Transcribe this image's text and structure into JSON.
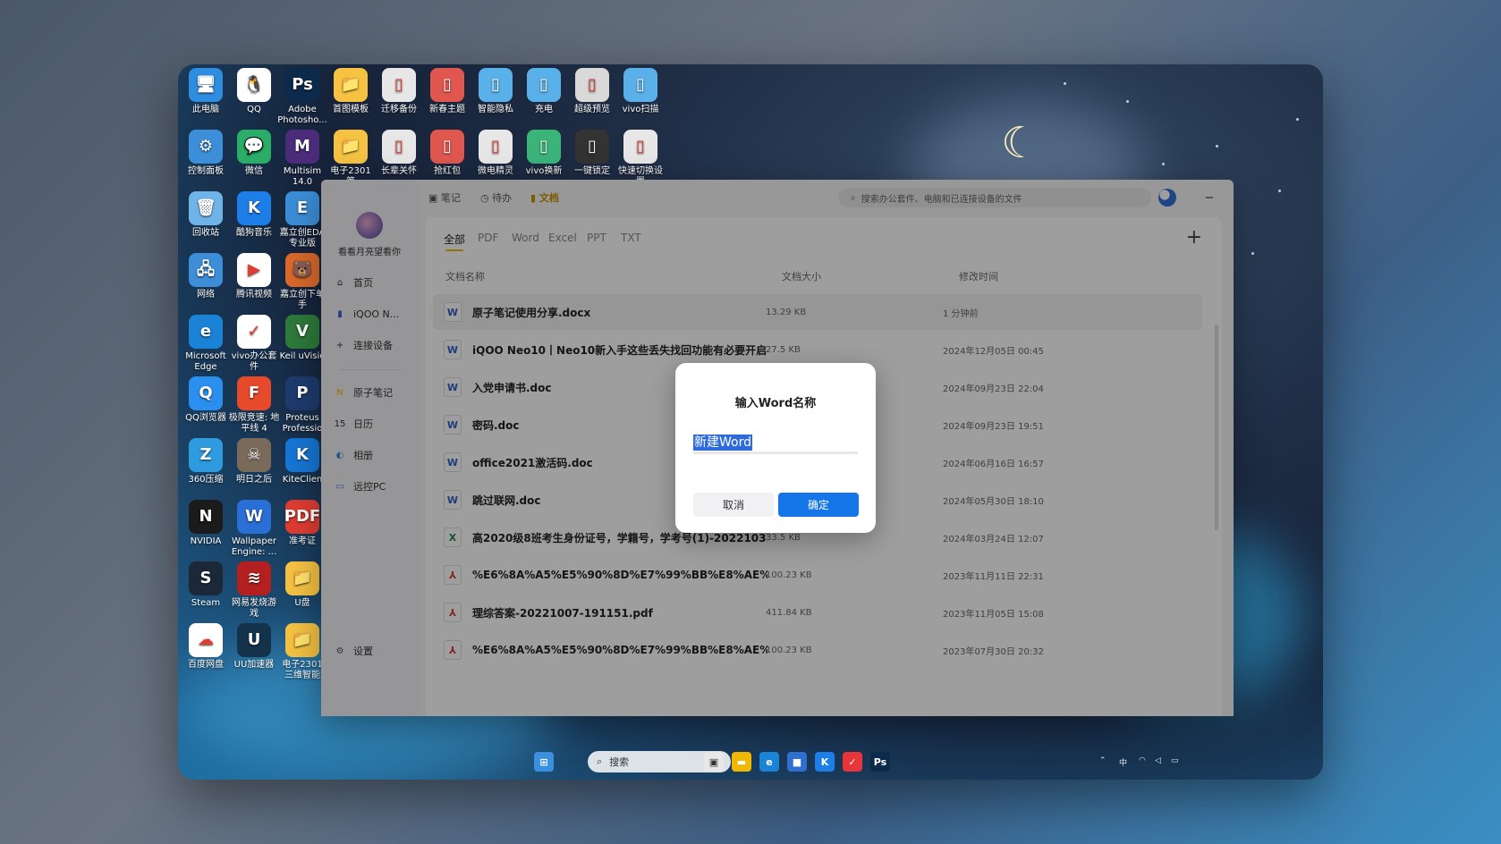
{
  "desktop": {
    "icons": [
      {
        "label": "此电脑",
        "color": "#2f8de0",
        "glyph": "🖥"
      },
      {
        "label": "QQ",
        "color": "#ffffff",
        "glyph": "🐧"
      },
      {
        "label": "Adobe Photosho...",
        "color": "#0c2a4b",
        "glyph": "Ps"
      },
      {
        "label": "首图模板",
        "color": "#f5c242",
        "glyph": "📁"
      },
      {
        "label": "迁移备份",
        "color": "#e7e7e7",
        "glyph": "▯"
      },
      {
        "label": "新春主题",
        "color": "#e0574f",
        "glyph": "▯"
      },
      {
        "label": "智能隐私",
        "color": "#5ab0e8",
        "glyph": "▯"
      },
      {
        "label": "充电",
        "color": "#5ab0e8",
        "glyph": "▯"
      },
      {
        "label": "超级预览",
        "color": "#d9d9d9",
        "glyph": "▯"
      },
      {
        "label": "vivo扫描",
        "color": "#5ab0e8",
        "glyph": "▯"
      },
      {
        "label": "控制面板",
        "color": "#3c8ed8",
        "glyph": "⚙"
      },
      {
        "label": "微信",
        "color": "#2aae67",
        "glyph": "💬"
      },
      {
        "label": "Multisim 14.0",
        "color": "#4b2c7a",
        "glyph": "M"
      },
      {
        "label": "电子2301 第",
        "color": "#f5c242",
        "glyph": "📁"
      },
      {
        "label": "长辈关怀",
        "color": "#e7e7e7",
        "glyph": "▯"
      },
      {
        "label": "抢红包",
        "color": "#e0574f",
        "glyph": "▯"
      },
      {
        "label": "微电精灵",
        "color": "#e7e7e7",
        "glyph": "▯"
      },
      {
        "label": "vivo换新",
        "color": "#3bb47a",
        "glyph": "▯"
      },
      {
        "label": "一键锁定",
        "color": "#333333",
        "glyph": "▯"
      },
      {
        "label": "快速切换设置",
        "color": "#e7e7e7",
        "glyph": "▯"
      },
      {
        "label": "回收站",
        "color": "#6fb4e8",
        "glyph": "🗑"
      },
      {
        "label": "酷狗音乐",
        "color": "#1d7ee8",
        "glyph": "K"
      },
      {
        "label": "嘉立创EDA 专业版",
        "color": "#3c8ed8",
        "glyph": "E"
      },
      {
        "label": "网络",
        "color": "#3c8ed8",
        "glyph": "🖧"
      },
      {
        "label": "腾讯视频",
        "color": "#ffffff",
        "glyph": "▶"
      },
      {
        "label": "嘉立创下单 手",
        "color": "#d9692a",
        "glyph": "🐻"
      },
      {
        "label": "Microsoft Edge",
        "color": "#1b83d6",
        "glyph": "e"
      },
      {
        "label": "vivo办公套件",
        "color": "#ffffff",
        "glyph": "✓"
      },
      {
        "label": "Keil uVisio",
        "color": "#2d7a3a",
        "glyph": "V"
      },
      {
        "label": "QQ浏览器",
        "color": "#2b8ff0",
        "glyph": "Q"
      },
      {
        "label": "极限竞速: 地平线 4",
        "color": "#e74a2a",
        "glyph": "F"
      },
      {
        "label": "Proteus Professio",
        "color": "#1e3b6e",
        "glyph": "P"
      },
      {
        "label": "360压缩",
        "color": "#2f9bdf",
        "glyph": "Z"
      },
      {
        "label": "明日之后",
        "color": "#7a6a5a",
        "glyph": "☠"
      },
      {
        "label": "KiteClien",
        "color": "#1676d4",
        "glyph": "K"
      },
      {
        "label": "NVIDIA",
        "color": "#1b1b1b",
        "glyph": "N"
      },
      {
        "label": "Wallpaper Engine: ...",
        "color": "#2a6fd6",
        "glyph": "W"
      },
      {
        "label": "准考证",
        "color": "#e03c31",
        "glyph": "PDF"
      },
      {
        "label": "Steam",
        "color": "#1b2838",
        "glyph": "S"
      },
      {
        "label": "网易发烧游戏",
        "color": "#b3201f",
        "glyph": "≋"
      },
      {
        "label": "U盘",
        "color": "#f5c242",
        "glyph": "📁"
      },
      {
        "label": "百度网盘",
        "color": "#ffffff",
        "glyph": "☁"
      },
      {
        "label": "UU加速器",
        "color": "#14334a",
        "glyph": "U"
      },
      {
        "label": "电子2301 三维智能",
        "color": "#f5c242",
        "glyph": "📁"
      }
    ]
  },
  "app": {
    "user_name": "看看月亮望看你",
    "nav": [
      {
        "label": "首页",
        "glyph": "⌂",
        "color": "#333333"
      },
      {
        "label": "iQOO N...",
        "glyph": "▮",
        "color": "#3a62c8"
      },
      {
        "label": "连接设备",
        "glyph": "+",
        "color": "#333333"
      }
    ],
    "nav2": [
      {
        "label": "原子笔记",
        "glyph": "N",
        "color": "#f2b700"
      },
      {
        "label": "日历",
        "glyph": "15",
        "color": "#333333"
      },
      {
        "label": "相册",
        "glyph": "◐",
        "color": "#3a8fd8"
      },
      {
        "label": "远控PC",
        "glyph": "▭",
        "color": "#4a7fd0"
      }
    ],
    "settings_label": "设置",
    "top_tabs": [
      "笔记",
      "待办",
      "文档"
    ],
    "search_placeholder": "搜索办公套件、电脑和已连接设备的文件",
    "window_buttons": {
      "minimize": "−",
      "maximize": "☐",
      "close": "✕"
    },
    "file_tabs": [
      "全部",
      "PDF",
      "Word",
      "Excel",
      "PPT",
      "TXT"
    ],
    "add_label": "+",
    "columns": {
      "name": "文档名称",
      "size": "文档大小",
      "time": "修改时间"
    },
    "files": [
      {
        "type": "W",
        "color": "#2f63c7",
        "name": "原子笔记使用分享.docx",
        "size": "13.29 KB",
        "time": "1 分钟前"
      },
      {
        "type": "W",
        "color": "#2f63c7",
        "name": "iQOO Neo10丨Neo10新入手这些丢失找回功能有必要开启!.doc",
        "size": "27.5 KB",
        "time": "2024年12月05日 00:45"
      },
      {
        "type": "W",
        "color": "#2f63c7",
        "name": "入党申请书.doc",
        "size": "",
        "time": "2024年09月23日 22:04"
      },
      {
        "type": "W",
        "color": "#2f63c7",
        "name": "密码.doc",
        "size": "",
        "time": "2024年09月23日 19:51"
      },
      {
        "type": "W",
        "color": "#2f63c7",
        "name": "office2021激活码.doc",
        "size": "",
        "time": "2024年06月16日 16:57"
      },
      {
        "type": "W",
        "color": "#2f63c7",
        "name": "跳过联网.doc",
        "size": "",
        "time": "2024年05月30日 18:10"
      },
      {
        "type": "X",
        "color": "#1e8a4c",
        "name": "高2020级8班考生身份证号，学籍号，学考号(1)-20221031... .xls",
        "size": "33.5 KB",
        "time": "2024年03月24日 12:07"
      },
      {
        "type": "⅄",
        "color": "#d23b2f",
        "name": "%E6%8A%A5%E5%90%8D%E7%99%BB%E8%AE%B0... .pdf",
        "size": "100.23 KB",
        "time": "2023年11月11日 22:31"
      },
      {
        "type": "⅄",
        "color": "#d23b2f",
        "name": "理综答案-20221007-191151.pdf",
        "size": "411.84 KB",
        "time": "2023年11月05日 15:08"
      },
      {
        "type": "⅄",
        "color": "#d23b2f",
        "name": "%E6%8A%A5%E5%90%8D%E7%99%BB%E8%AE%B0... .pdf",
        "size": "100.23 KB",
        "time": "2023年07月30日 20:32"
      }
    ]
  },
  "dialog": {
    "title": "输入Word名称",
    "input_value": "新建Word",
    "cancel_label": "取消",
    "ok_label": "确定"
  },
  "taskbar": {
    "search_label": "搜索",
    "apps": [
      {
        "name": "start",
        "glyph": "⊞",
        "color": "#3a8fe0"
      },
      {
        "name": "task-view",
        "glyph": "▣",
        "color": "#e8e8e8"
      },
      {
        "name": "file-explorer",
        "glyph": "▬",
        "color": "#f2b700"
      },
      {
        "name": "edge",
        "glyph": "e",
        "color": "#1b83d6"
      },
      {
        "name": "store",
        "glyph": "■",
        "color": "#2f6fd0"
      },
      {
        "name": "kugou",
        "glyph": "K",
        "color": "#1d7ee8"
      },
      {
        "name": "vivo-office",
        "glyph": "✓",
        "color": "#e8353a"
      },
      {
        "name": "photoshop",
        "glyph": "Ps",
        "color": "#0c2a4b"
      }
    ],
    "tray_lang": "中"
  }
}
